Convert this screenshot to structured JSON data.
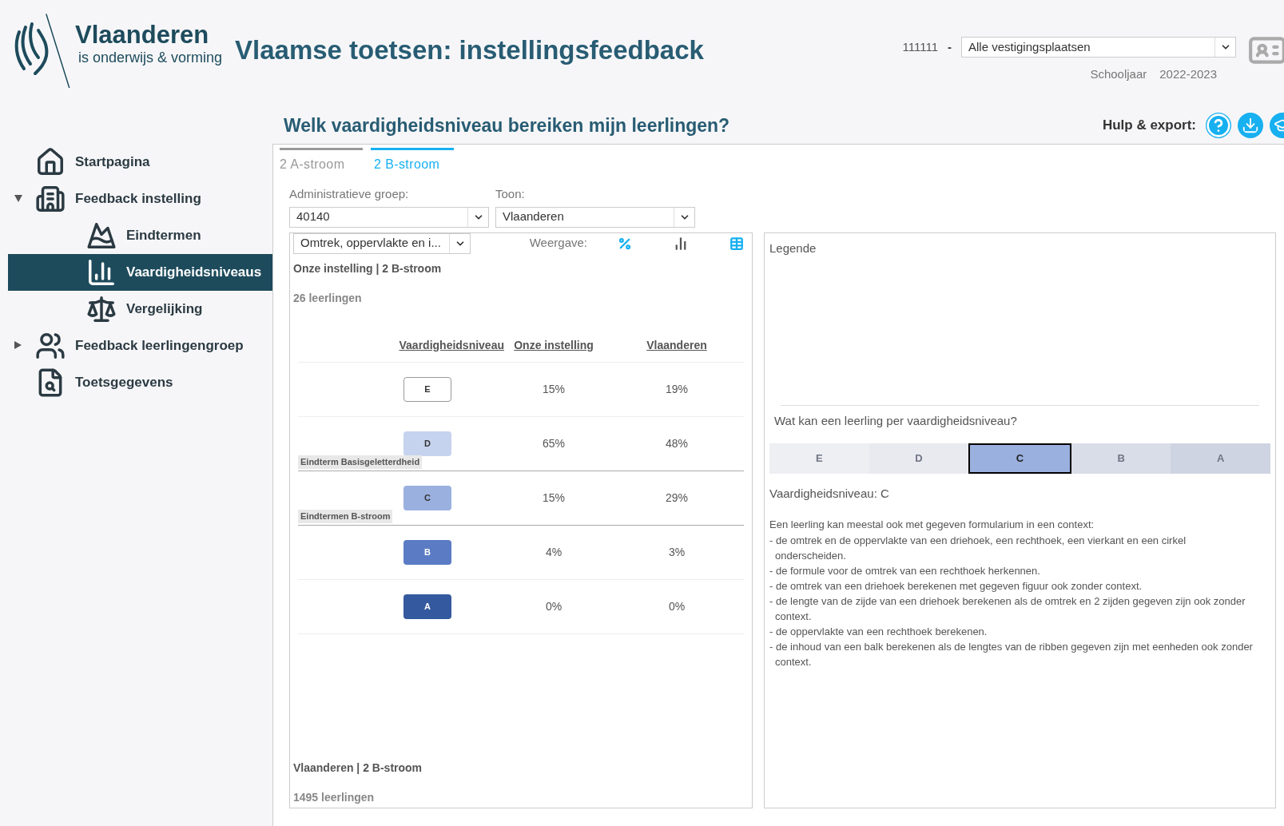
{
  "header": {
    "logo_name": "Vlaanderen",
    "logo_tagline": "is onderwijs & vorming",
    "title": "Vlaamse toetsen: instellingsfeedback",
    "institution_number": "111111",
    "separator": "-",
    "location_select": "Alle vestigingsplaatsen",
    "schoolyear_label": "Schooljaar",
    "schoolyear": "2022-2023"
  },
  "sidebar": {
    "items": [
      {
        "label": "Startpagina",
        "kind": "home",
        "selected": false
      },
      {
        "label": "Feedback instelling",
        "kind": "building",
        "selected": false,
        "expanded": true,
        "children": [
          {
            "label": "Eindtermen",
            "kind": "mountain",
            "selected": false
          },
          {
            "label": "Vaardigheidsniveaus",
            "kind": "bars",
            "selected": true
          },
          {
            "label": "Vergelijking",
            "kind": "scale",
            "selected": false
          }
        ]
      },
      {
        "label": "Feedback leerlingengroep",
        "kind": "users",
        "selected": false,
        "expanded": false
      },
      {
        "label": "Toetsgegevens",
        "kind": "file",
        "selected": false
      }
    ]
  },
  "page_heading": "Welk vaardigheidsniveau bereiken mijn leerlingen?",
  "help_label": "Hulp & export:",
  "tabs": [
    {
      "label": "2 A-stroom",
      "selected": false
    },
    {
      "label": "2 B-stroom",
      "selected": true
    }
  ],
  "filters": [
    {
      "label": "Administratieve groep:",
      "value": "40140"
    },
    {
      "label": "Toon:",
      "value": "Vlaanderen"
    }
  ],
  "left_panel": {
    "subject_select": "Omtrek, oppervlakte en i...",
    "display_label": "Weergave:",
    "display_options": [
      {
        "kind": "percent",
        "selected": true
      },
      {
        "kind": "bars",
        "selected": false
      },
      {
        "kind": "table",
        "selected": true
      }
    ],
    "group_title": "Onze instelling | 2 B-stroom",
    "group_count": "26 leerlingen",
    "columns": [
      "Vaardigheidsniveau",
      "Onze instelling",
      "Vlaanderen"
    ],
    "rows": [
      {
        "level": "E",
        "color": "#ffffff",
        "ours": "15%",
        "flanders": "19%"
      },
      {
        "level": "D",
        "color": "#c5d3ee",
        "ours": "65%",
        "flanders": "48%",
        "tag": "Eindterm Basisgeletterdheid"
      },
      {
        "level": "C",
        "color": "#9ab0df",
        "ours": "15%",
        "flanders": "29%",
        "tag": "Eindtermen B-stroom"
      },
      {
        "level": "B",
        "color": "#5b7cc4",
        "ours": "4%",
        "flanders": "3%"
      },
      {
        "level": "A",
        "color": "#35599e",
        "ours": "0%",
        "flanders": "0%"
      }
    ],
    "footer_title": "Vlaanderen | 2 B-stroom",
    "footer_count": "1495 leerlingen"
  },
  "right_panel": {
    "legend_title": "Legende",
    "question": "Wat kan een leerling per vaardigheidsniveau?",
    "levels": [
      {
        "label": "E",
        "color": "#eeeff2",
        "selected": false
      },
      {
        "label": "D",
        "color": "#e8eaf0",
        "selected": false
      },
      {
        "label": "C",
        "color": "#9ab0df",
        "selected": true
      },
      {
        "label": "B",
        "color": "#d9dde8",
        "selected": false
      },
      {
        "label": "A",
        "color": "#cfd4e2",
        "selected": false
      }
    ],
    "level_title": "Vaardigheidsniveau: C",
    "intro": "Een leerling kan meestal ook met gegeven formularium in een context:",
    "bullets": [
      "- de omtrek en de oppervlakte van een driehoek, een rechthoek, een vierkant en een cirkel onderscheiden.",
      "- de formule voor de omtrek van een rechthoek herkennen.",
      "- de omtrek van een driehoek berekenen met gegeven figuur ook zonder context.",
      "- de lengte van de zijde van een driehoek berekenen als de omtrek en 2 zijden gegeven zijn ook zonder context.",
      "- de oppervlakte van een rechthoek berekenen.",
      "- de inhoud van een balk berekenen als de lengtes van de ribben gegeven zijn met eenheden ook zonder context."
    ]
  }
}
